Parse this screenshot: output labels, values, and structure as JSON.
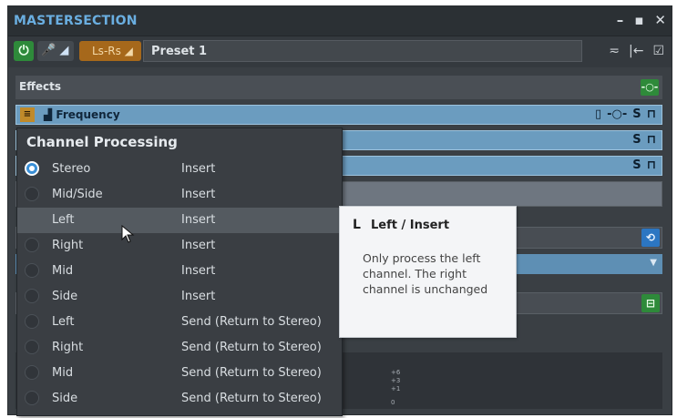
{
  "window": {
    "title": "MASTERSECTION",
    "buttons": [
      "minimize",
      "restore",
      "close"
    ]
  },
  "toolbar": {
    "power_icon": "power-icon",
    "mic_icon": "microphone-icon",
    "channel_label": "Ls-Rs",
    "preset_name": "Preset 1",
    "right_icons": [
      "preset-save-icon",
      "import-icon",
      "check-icon"
    ]
  },
  "effects": {
    "header_label": "Effects",
    "add_icon": "plugin-add-icon",
    "plugin_name": "Frequency"
  },
  "menu": {
    "title": "Channel Processing",
    "items": [
      {
        "a": "Stereo",
        "b": "Insert",
        "selected": true
      },
      {
        "a": "Mid/Side",
        "b": "Insert"
      },
      {
        "a": "Left",
        "b": "Insert",
        "highlighted": true
      },
      {
        "a": "Right",
        "b": "Insert"
      },
      {
        "a": "Mid",
        "b": "Insert"
      },
      {
        "a": "Side",
        "b": "Insert"
      },
      {
        "a": "Left",
        "b": "Send (Return to Stereo)"
      },
      {
        "a": "Right",
        "b": "Send (Return to Stereo)"
      },
      {
        "a": "Mid",
        "b": "Send (Return to Stereo)"
      },
      {
        "a": "Side",
        "b": "Send (Return to Stereo)"
      }
    ]
  },
  "tooltip": {
    "title": "Left / Insert",
    "body": "Only process the left channel. The right channel is unchanged"
  },
  "meter": {
    "scale": [
      "+6",
      "+3",
      "+1",
      "0"
    ]
  },
  "colors": {
    "title_blue": "#6aaee0",
    "power_green": "#2e8a3a",
    "channel_orange": "#a6681b",
    "plugin_blue": "#6b9cbf",
    "radio_selected": "#3a8fd6"
  }
}
